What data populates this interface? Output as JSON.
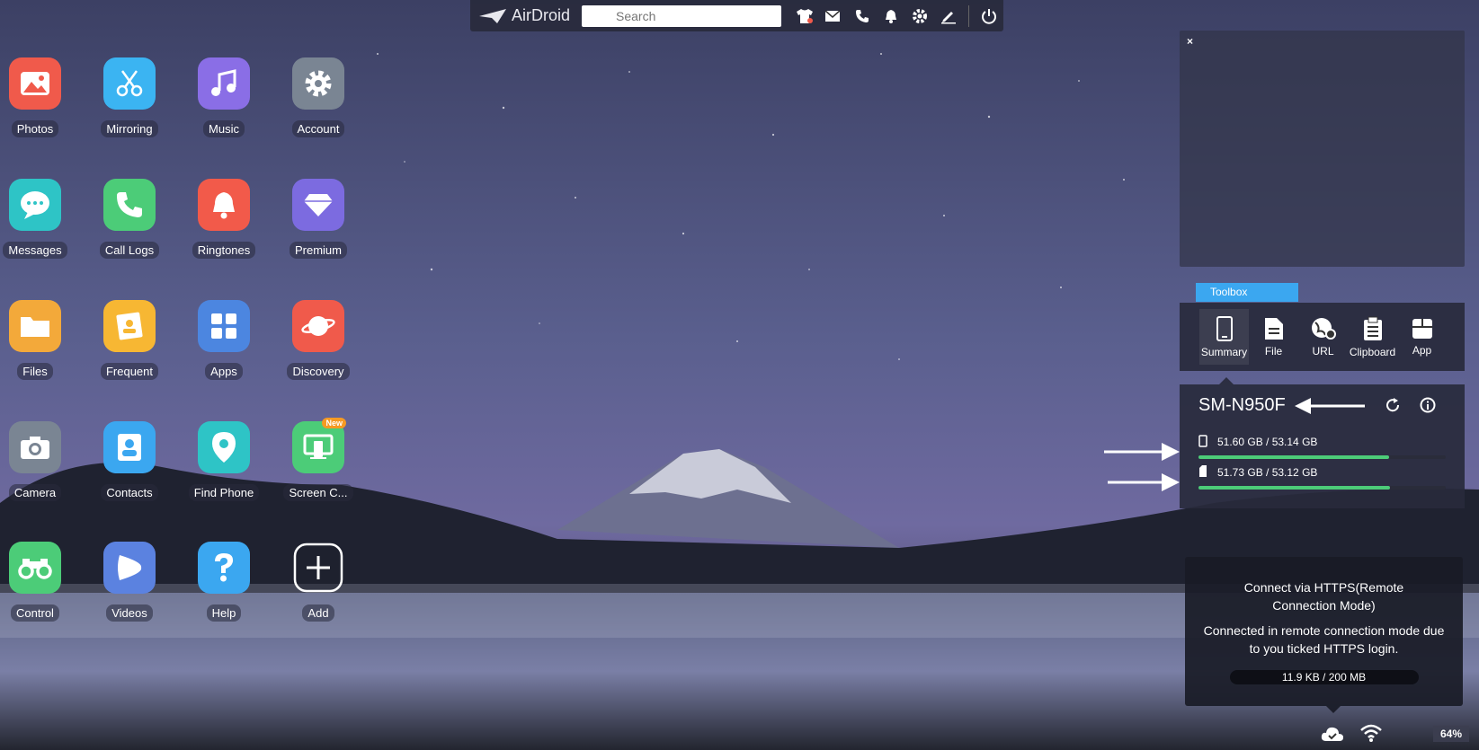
{
  "topbar": {
    "logo_text": "AirDroid",
    "search_placeholder": "Search",
    "icons": [
      "tshirt-icon",
      "mail-icon",
      "phone-icon",
      "bell-icon",
      "gear-icon",
      "edit-icon",
      "power-icon"
    ]
  },
  "apps": [
    {
      "label": "Photos",
      "icon": "photos-icon",
      "color": "#f05a4b"
    },
    {
      "label": "Mirroring",
      "icon": "scissors-icon",
      "color": "#3bb4f2"
    },
    {
      "label": "Music",
      "icon": "music-icon",
      "color": "#8a6ee6"
    },
    {
      "label": "Account",
      "icon": "gear-icon",
      "color": "#7a8593"
    },
    {
      "label": "Messages",
      "icon": "chat-icon",
      "color": "#2ec4c6"
    },
    {
      "label": "Call Logs",
      "icon": "phone-icon",
      "color": "#4ccc78"
    },
    {
      "label": "Ringtones",
      "icon": "bell-icon",
      "color": "#f25a4a"
    },
    {
      "label": "Premium",
      "icon": "diamond-icon",
      "color": "#7c6be0"
    },
    {
      "label": "Files",
      "icon": "folder-icon",
      "color": "#f3a93a"
    },
    {
      "label": "Frequent",
      "icon": "contact-card-icon",
      "color": "#f7b733"
    },
    {
      "label": "Apps",
      "icon": "grid-icon",
      "color": "#4c86e0"
    },
    {
      "label": "Discovery",
      "icon": "planet-icon",
      "color": "#f05a4b"
    },
    {
      "label": "Camera",
      "icon": "camera-icon",
      "color": "#7a8593"
    },
    {
      "label": "Contacts",
      "icon": "contacts-icon",
      "color": "#3ba7f0"
    },
    {
      "label": "Find Phone",
      "icon": "location-pin-icon",
      "color": "#2ec4c6"
    },
    {
      "label": "Screen C...",
      "icon": "screen-cast-icon",
      "color": "#4ccc78",
      "badge": "New"
    },
    {
      "label": "Control",
      "icon": "binoculars-icon",
      "color": "#4ccc78"
    },
    {
      "label": "Videos",
      "icon": "play-icon",
      "color": "#5b82e0"
    },
    {
      "label": "Help",
      "icon": "question-icon",
      "color": "#3ba7f0"
    },
    {
      "label": "Add",
      "icon": "plus-icon",
      "color": "transparent"
    }
  ],
  "preview": {
    "close_label": "×"
  },
  "toolbox": {
    "tab_label": "Toolbox",
    "tools": [
      {
        "label": "Summary",
        "icon": "phone-device-icon"
      },
      {
        "label": "File",
        "icon": "file-icon"
      },
      {
        "label": "URL",
        "icon": "globe-link-icon"
      },
      {
        "label": "Clipboard",
        "icon": "clipboard-icon"
      },
      {
        "label": "App",
        "icon": "app-box-icon"
      }
    ]
  },
  "summary": {
    "device_name": "SM-N950F",
    "internal_storage": {
      "text": "51.60 GB / 53.14 GB",
      "fill_fraction": 0.771
    },
    "sd_storage": {
      "text": "51.73 GB / 53.12 GB",
      "fill_fraction": 0.774
    }
  },
  "connection": {
    "title": "Connect via HTTPS(Remote Connection Mode)",
    "description": "Connected in remote connection mode due to you ticked HTTPS login.",
    "usage": "11.9 KB / 200 MB"
  },
  "status": {
    "battery": "64%"
  },
  "colors": {
    "accent": "#3ba7f0",
    "progress": "#4ccc78",
    "panel": "#282a3c"
  }
}
